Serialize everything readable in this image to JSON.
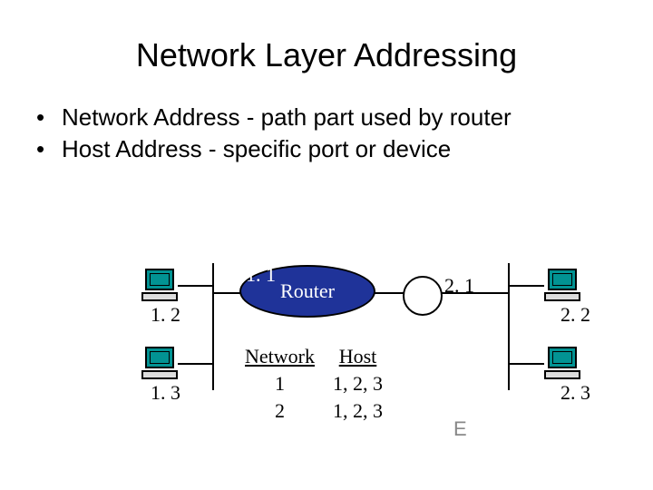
{
  "title": "Network Layer Addressing",
  "bullets": [
    "Network Address - path part used by router",
    "Host Address - specific port or device"
  ],
  "labels": {
    "pc_left_top": "1. 2",
    "pc_left_bot": "1. 3",
    "pc_right_top": "2. 2",
    "pc_right_bot": "2. 3",
    "router_left": "1. 1",
    "router_right": "2. 1",
    "router_name": "Router"
  },
  "table": {
    "headers": [
      "Network",
      "Host"
    ],
    "rows": [
      [
        "1",
        "1, 2, 3"
      ],
      [
        "2",
        "1, 2, 3"
      ]
    ]
  },
  "mark": "E"
}
